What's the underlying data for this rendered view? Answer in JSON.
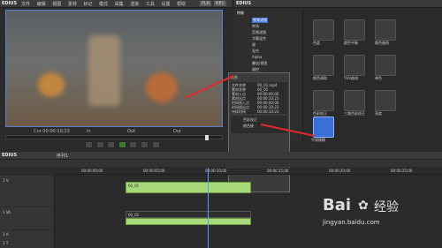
{
  "player": {
    "app_name": "EDIUS",
    "menu": [
      "文件",
      "编辑",
      "视图",
      "素材",
      "标记",
      "模式",
      "采集",
      "渲染",
      "工具",
      "设置",
      "帮助"
    ],
    "mode_badge": "PLR",
    "rec_badge": "REC",
    "timecode_labels": [
      "Cur 00:00:10;23",
      "In",
      "Out",
      "Dur"
    ]
  },
  "effects_panel": {
    "title": "EDIUS",
    "tab_label": "特效",
    "folder_root": "特效",
    "tree": [
      "视频滤镜",
      "转场",
      "音频滤镜",
      "字幕混合",
      "键",
      "混合",
      "Alpha",
      "叠加/视图",
      "键控",
      "颜色"
    ],
    "tiles": [
      "色度",
      "颜色平衡",
      "颜色曲线",
      "颜色调和",
      "YUV曲线",
      "单色",
      "色彩校正",
      "三路色彩校正",
      "亮度",
      "平滑模糊",
      "混合滤镜",
      "颜色键"
    ]
  },
  "info_popup": {
    "title": "信息",
    "rows": [
      {
        "k": "文件名称",
        "v": "00_01.mp4"
      },
      {
        "k": "素材名称",
        "v": "00_01"
      },
      {
        "k": "素材入点",
        "v": "00:00:00;00"
      },
      {
        "k": "素材出点",
        "v": "00:00:10;23"
      },
      {
        "k": "时间线入点",
        "v": "00:00:00;00"
      },
      {
        "k": "时间线出点",
        "v": "00:00:10;23"
      },
      {
        "k": "持续时间",
        "v": "00:00:10;23"
      }
    ],
    "effects": [
      "色彩校正",
      "颜色键"
    ],
    "footer": "信息"
  },
  "timeline": {
    "title": "EDIUS",
    "sequence": "序列1",
    "ruler": [
      "00:00:00;00",
      "00:00:05;00",
      "00:00:10;00",
      "00:00:15;00",
      "00:00:20;00",
      "00:00:25;00"
    ],
    "tracks": [
      {
        "name": "1 V",
        "clip": "00_01"
      },
      {
        "name": "1 VA",
        "clip": "00_01"
      },
      {
        "name": "1 A",
        "clip": ""
      },
      {
        "name": "1 T",
        "clip": ""
      }
    ],
    "status_left": "视频",
    "status_right": "音频"
  },
  "watermark": {
    "brand": "Bai",
    "brand_cn": "经验",
    "url": "jingyan.baidu.com"
  },
  "colors": {
    "accent": "#e02a2a",
    "clip": "#a7d87a",
    "selection": "#3a6fd8"
  }
}
